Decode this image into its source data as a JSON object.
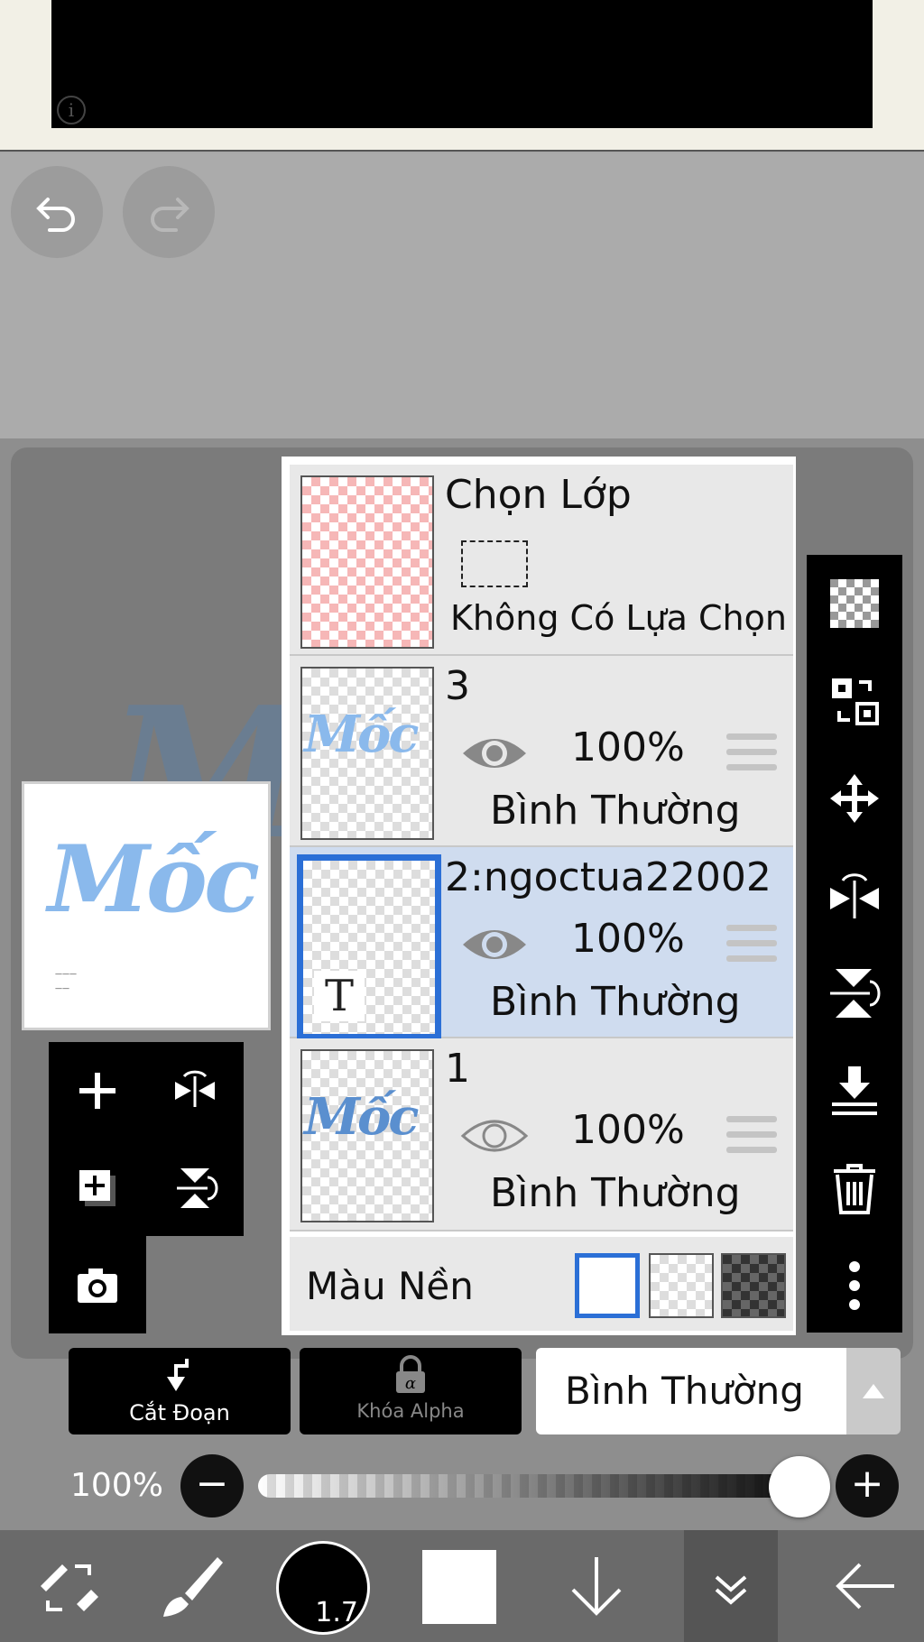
{
  "layers_panel": {
    "selection_row": {
      "title": "Chọn Lớp",
      "status": "Không Có Lựa Chọn"
    },
    "layers": [
      {
        "name": "3",
        "opacity": "100%",
        "blend": "Bình Thường",
        "thumb_text": "Mốc",
        "visible": true
      },
      {
        "name": "2:ngoctua22002",
        "opacity": "100%",
        "blend": "Bình Thường",
        "thumb_text": "T",
        "visible": true,
        "selected": true
      },
      {
        "name": "1",
        "opacity": "100%",
        "blend": "Bình Thường",
        "thumb_text": "Mốc",
        "visible": false
      }
    ],
    "background_color_label": "Màu Nền"
  },
  "preview": {
    "word": "Mốc"
  },
  "blend_bar": {
    "clipping_label": "Cắt Đoạn",
    "alpha_lock_label": "Khóa Alpha",
    "blend_mode": "Bình Thường"
  },
  "opacity_row": {
    "value": "100%",
    "level": 1.0
  },
  "bottom_bar": {
    "brush_size": "1.7"
  },
  "colors": {
    "accent": "#2b6fd6",
    "selected_row": "#cfdcef",
    "ink_blue": "#8ab9ec"
  }
}
